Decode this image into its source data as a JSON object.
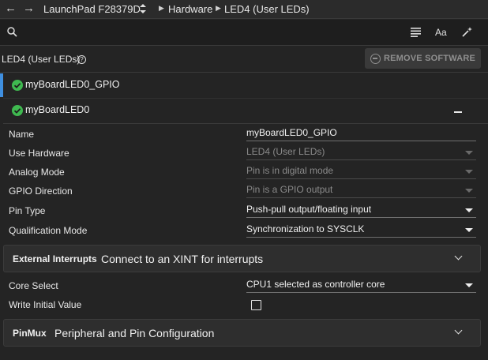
{
  "topbar": {
    "back_glyph": "←",
    "forward_glyph": "→",
    "device": "LaunchPad F28379D",
    "crumbs": [
      "Hardware",
      "LED4 (User LEDs)"
    ]
  },
  "header": {
    "title": "LED4 (User LEDs)",
    "help_glyph": "?",
    "remove_label": "REMOVE SOFTWARE"
  },
  "instances": [
    {
      "label": "myBoardLED0_GPIO"
    },
    {
      "label": "myBoardLED0"
    }
  ],
  "properties": {
    "name": {
      "label": "Name",
      "value": "myBoardLED0_GPIO"
    },
    "use_hardware": {
      "label": "Use Hardware",
      "value": "LED4 (User LEDs)"
    },
    "analog_mode": {
      "label": "Analog Mode",
      "value": "Pin is in digital mode"
    },
    "gpio_direction": {
      "label": "GPIO Direction",
      "value": "Pin is a GPIO output"
    },
    "pin_type": {
      "label": "Pin Type",
      "value": "Push-pull output/floating input"
    },
    "qualification_mode": {
      "label": "Qualification Mode",
      "value": "Synchronization to SYSCLK"
    },
    "core_select": {
      "label": "Core Select",
      "value": "CPU1 selected as controller core"
    },
    "write_initial_value": {
      "label": "Write Initial Value",
      "checked": false
    }
  },
  "panels": {
    "external_interrupts": {
      "tag": "External Interrupts",
      "text": "Connect to an XINT for interrupts"
    },
    "pinmux": {
      "tag": "PinMux",
      "text": "Peripheral and Pin Configuration"
    }
  },
  "colors": {
    "accent": "#3f8fe0",
    "success": "#3fb950",
    "background": "#242424"
  }
}
